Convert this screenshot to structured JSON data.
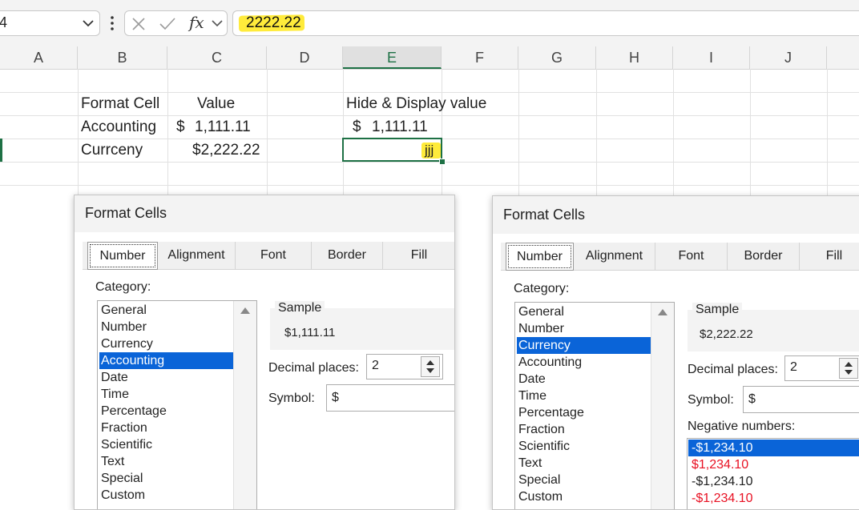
{
  "formula_bar": {
    "name_box_fragment": "4",
    "formula_value": "2222.22",
    "cancel_icon": "close-icon",
    "enter_icon": "check-icon",
    "function_icon": "fx-icon"
  },
  "columns": [
    "A",
    "B",
    "C",
    "D",
    "E",
    "F",
    "G",
    "H",
    "I",
    "J"
  ],
  "sheet": {
    "b_header": "Format Cell",
    "c_header": "Value",
    "e_header": "Hide & Display value",
    "row_accounting_label": "Accounting",
    "row_accounting_symbol": "$",
    "row_accounting_value": "1,111.11",
    "row_accounting_display_symbol": "$",
    "row_accounting_display_value": "1,111.11",
    "row_currency_label": "Currceny",
    "row_currency_value": "$2,222.22",
    "row_currency_display": "jjj"
  },
  "dialog_left": {
    "title": "Format Cells",
    "tabs": [
      "Number",
      "Alignment",
      "Font",
      "Border",
      "Fill"
    ],
    "category_label": "Category:",
    "categories": [
      "General",
      "Number",
      "Currency",
      "Accounting",
      "Date",
      "Time",
      "Percentage",
      "Fraction",
      "Scientific",
      "Text",
      "Special",
      "Custom"
    ],
    "selected_category": "Accounting",
    "sample_label": "Sample",
    "sample_value": "$1,111.11",
    "decimal_label": "Decimal places:",
    "decimal_value": "2",
    "symbol_label": "Symbol:",
    "symbol_value": "$"
  },
  "dialog_right": {
    "title": "Format Cells",
    "tabs": [
      "Number",
      "Alignment",
      "Font",
      "Border",
      "Fill"
    ],
    "category_label": "Category:",
    "categories": [
      "General",
      "Number",
      "Currency",
      "Accounting",
      "Date",
      "Time",
      "Percentage",
      "Fraction",
      "Scientific",
      "Text",
      "Special",
      "Custom"
    ],
    "selected_category": "Currency",
    "sample_label": "Sample",
    "sample_value": "$2,222.22",
    "decimal_label": "Decimal places:",
    "decimal_value": "2",
    "symbol_label": "Symbol:",
    "symbol_value": "$",
    "negative_label": "Negative numbers:",
    "negative_options": [
      "-$1,234.10",
      "$1,234.10",
      "-$1,234.10",
      "-$1,234.10"
    ],
    "negative_colors": [
      "#ffffff",
      "#e81123",
      "#1f1f1f",
      "#e81123"
    ],
    "selected_negative": "-$1,234.10"
  },
  "colors": {
    "selection": "#0a64d8",
    "excel_green": "#1e7145",
    "highlight": "#ffeb3b",
    "negative_red": "#e81123"
  }
}
